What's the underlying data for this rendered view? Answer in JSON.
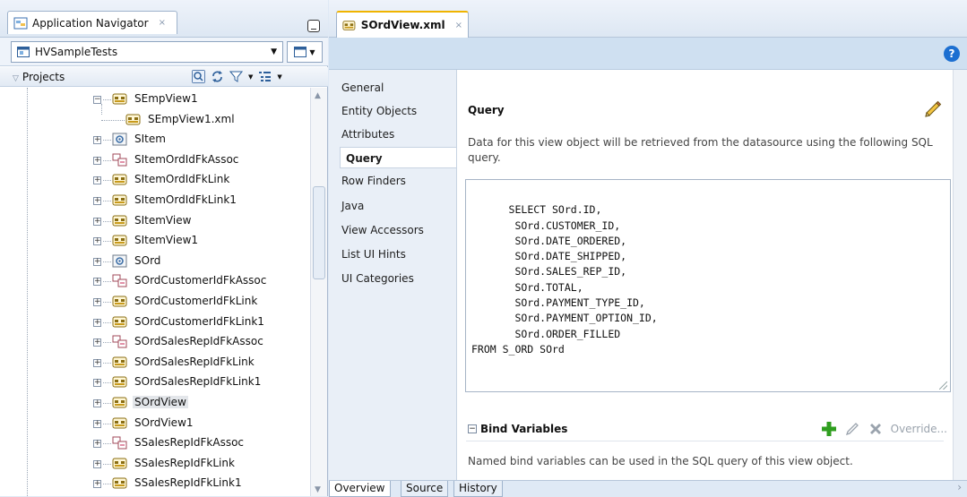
{
  "navigator": {
    "tab_label": "Application Navigator",
    "tab_close": "×",
    "application": "HVSampleTests",
    "projects_label": "Projects"
  },
  "tree": {
    "items": [
      {
        "label": "SEmpView1",
        "type": "view",
        "level": 1,
        "expanded": true
      },
      {
        "label": "SEmpView1.xml",
        "type": "xml",
        "level": 2
      },
      {
        "label": "SItem",
        "type": "entity",
        "level": 1
      },
      {
        "label": "SItemOrdIdFkAssoc",
        "type": "assoc",
        "level": 1
      },
      {
        "label": "SItemOrdIdFkLink",
        "type": "view",
        "level": 1
      },
      {
        "label": "SItemOrdIdFkLink1",
        "type": "view",
        "level": 1
      },
      {
        "label": "SItemView",
        "type": "view",
        "level": 1
      },
      {
        "label": "SItemView1",
        "type": "view",
        "level": 1
      },
      {
        "label": "SOrd",
        "type": "entity",
        "level": 1
      },
      {
        "label": "SOrdCustomerIdFkAssoc",
        "type": "assoc",
        "level": 1
      },
      {
        "label": "SOrdCustomerIdFkLink",
        "type": "view",
        "level": 1
      },
      {
        "label": "SOrdCustomerIdFkLink1",
        "type": "view",
        "level": 1
      },
      {
        "label": "SOrdSalesRepIdFkAssoc",
        "type": "assoc",
        "level": 1
      },
      {
        "label": "SOrdSalesRepIdFkLink",
        "type": "view",
        "level": 1
      },
      {
        "label": "SOrdSalesRepIdFkLink1",
        "type": "view",
        "level": 1
      },
      {
        "label": "SOrdView",
        "type": "view",
        "level": 1,
        "selected": true
      },
      {
        "label": "SOrdView1",
        "type": "view",
        "level": 1
      },
      {
        "label": "SSalesRepIdFkAssoc",
        "type": "assoc",
        "level": 1
      },
      {
        "label": "SSalesRepIdFkLink",
        "type": "view",
        "level": 1
      },
      {
        "label": "SSalesRepIdFkLink1",
        "type": "view",
        "level": 1
      }
    ]
  },
  "editor": {
    "tab_label": "SOrdView.xml",
    "tab_close": "×",
    "help": "?",
    "sidenav": [
      "General",
      "Entity Objects",
      "Attributes",
      "Query",
      "Row Finders",
      "Java",
      "View Accessors",
      "List UI Hints",
      "UI Categories"
    ],
    "active_section": "Query",
    "query": {
      "title": "Query",
      "description": "Data for this view object will be retrieved from the datasource using the following SQL query.",
      "sql": "SELECT SOrd.ID,\n       SOrd.CUSTOMER_ID,\n       SOrd.DATE_ORDERED,\n       SOrd.DATE_SHIPPED,\n       SOrd.SALES_REP_ID,\n       SOrd.TOTAL,\n       SOrd.PAYMENT_TYPE_ID,\n       SOrd.PAYMENT_OPTION_ID,\n       SOrd.ORDER_FILLED\nFROM S_ORD SOrd"
    },
    "bind": {
      "title": "Bind Variables",
      "collapse": "−",
      "override_label": "Override...",
      "description": "Named bind variables can be used in the SQL query of this view object."
    },
    "bottom_tabs": [
      "Overview",
      "Source",
      "History"
    ],
    "active_bottom_tab": "Overview"
  },
  "colors": {
    "accent": "#1c6fd1",
    "add_green": "#2f9e1f",
    "tab_highlight": "#f0b400"
  }
}
